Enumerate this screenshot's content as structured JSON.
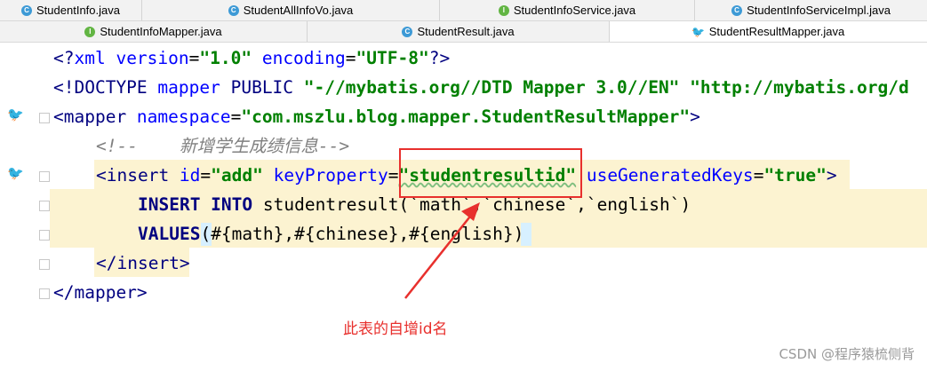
{
  "tabs_row1": [
    {
      "label": "StudentInfo.java",
      "icon": "class-icon"
    },
    {
      "label": "StudentAllInfoVo.java",
      "icon": "class-icon"
    },
    {
      "label": "StudentInfoService.java",
      "icon": "interface-icon"
    },
    {
      "label": "StudentInfoServiceImpl.java",
      "icon": "class-icon"
    }
  ],
  "tabs_row2": [
    {
      "label": "StudentInfoMapper.java",
      "icon": "interface-icon"
    },
    {
      "label": "StudentResult.java",
      "icon": "class-icon"
    },
    {
      "label": "StudentResultMapper.java",
      "icon": "mybatis-icon"
    }
  ],
  "code": {
    "l1_a": "<?",
    "l1_b": "xml ",
    "l1_c": "version",
    "l1_d": "=",
    "l1_e": "\"1.0\"",
    "l1_f": " encoding",
    "l1_g": "=",
    "l1_h": "\"UTF-8\"",
    "l1_i": "?>",
    "l2_a": "<!DOCTYPE ",
    "l2_b": "mapper ",
    "l2_c": "PUBLIC ",
    "l2_d": "\"-//mybatis.org//DTD Mapper 3.0//EN\" ",
    "l2_e": "\"http://mybatis.org/d",
    "l3_a": "<mapper ",
    "l3_b": "namespace",
    "l3_c": "=",
    "l3_d": "\"com.mszlu.blog.mapper.StudentResultMapper\"",
    "l3_e": ">",
    "l4": "<!--    新增学生成绩信息-->",
    "l5_a": "<insert ",
    "l5_b": "id",
    "l5_c": "=",
    "l5_d": "\"add\"",
    "l5_e": " keyProperty",
    "l5_f": "=",
    "l5_g": "\"studentresultid\"",
    "l5_h": " useGeneratedKeys",
    "l5_i": "=",
    "l5_j": "\"true\"",
    "l5_k": ">",
    "l6_a": "INSERT INTO ",
    "l6_b": "studentresult(`math`,`chinese`,`english`)",
    "l7_a": "VALUES",
    "l7_b": "(#{math},#{chinese},#{english})",
    "l8": "</insert>",
    "l9": "</mapper>"
  },
  "annotation": "此表的自增id名",
  "watermark": "CSDN @程序猿梳侧背",
  "colors": {
    "tag": "#000080",
    "attribute": "#0000ff",
    "string": "#008000",
    "comment": "#808080",
    "annotation_red": "#e8302d",
    "highlight": "#fcf3d1"
  }
}
